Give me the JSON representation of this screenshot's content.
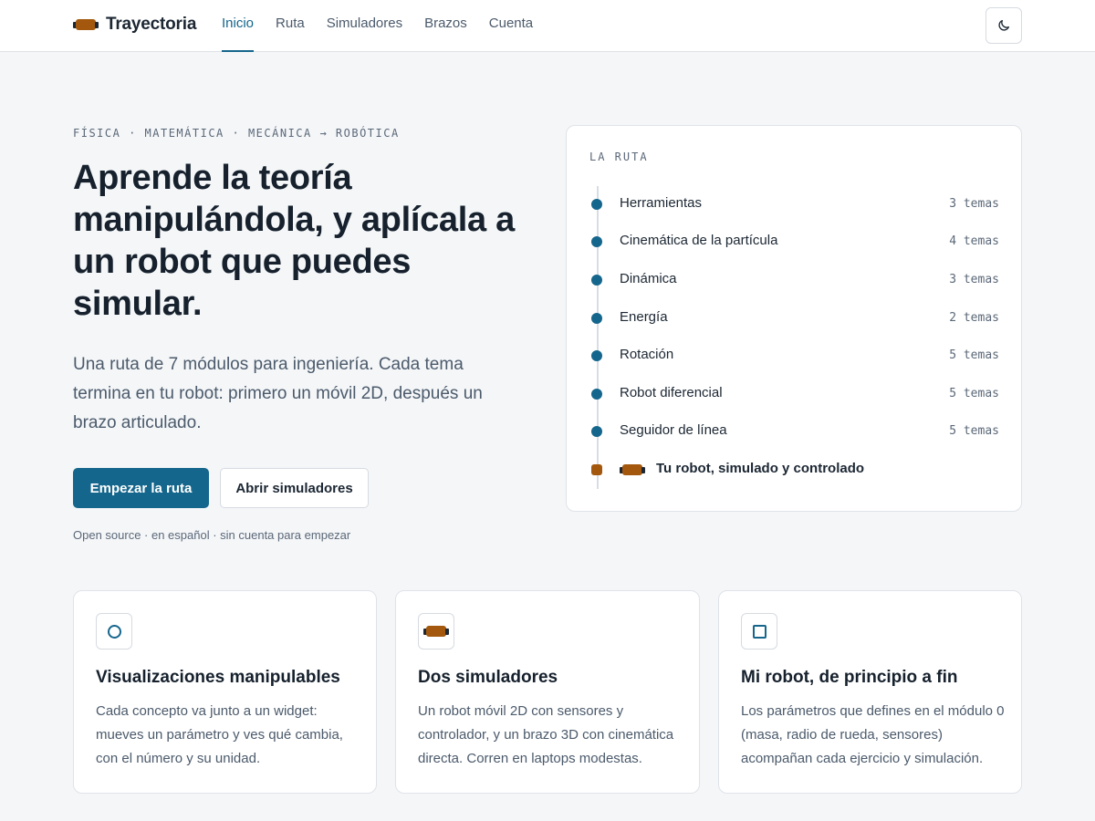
{
  "header": {
    "brand": "Trayectoria",
    "nav": [
      "Inicio",
      "Ruta",
      "Simuladores",
      "Brazos",
      "Cuenta"
    ],
    "active_nav": "Inicio",
    "theme_icon": "moon-icon"
  },
  "hero": {
    "eyebrow": "FÍSICA · MATEMÁTICA · MECÁNICA → ROBÓTICA",
    "title": "Aprende la teoría manipulándola, y aplícala a un robot que puedes simular.",
    "description": "Una ruta de 7 módulos para ingeniería. Cada tema termina en tu robot: primero un móvil 2D, después un brazo articulado.",
    "primary_button": "Empezar la ruta",
    "secondary_button": "Abrir simuladores",
    "footnote": "Open source · en español · sin cuenta para empezar"
  },
  "route": {
    "label": "LA RUTA",
    "items": [
      {
        "label": "Herramientas",
        "count": "3 temas"
      },
      {
        "label": "Cinemática de la partícula",
        "count": "4 temas"
      },
      {
        "label": "Dinámica",
        "count": "3 temas"
      },
      {
        "label": "Energía",
        "count": "2 temas"
      },
      {
        "label": "Rotación",
        "count": "5 temas"
      },
      {
        "label": "Robot diferencial",
        "count": "5 temas"
      },
      {
        "label": "Seguidor de línea",
        "count": "5 temas"
      }
    ],
    "final": "Tu robot, simulado y controlado"
  },
  "features": [
    {
      "icon": "circle-icon",
      "title": "Visualizaciones manipulables",
      "description": "Cada concepto va junto a un widget: mueves un parámetro y ves qué cambia, con el número y su unidad."
    },
    {
      "icon": "robot-icon",
      "title": "Dos simuladores",
      "description": "Un robot móvil 2D con sensores y controlador, y un brazo 3D con cinemática directa. Corren en laptops modestas."
    },
    {
      "icon": "square-icon",
      "title": "Mi robot, de principio a fin",
      "description": "Los parámetros que defines en el módulo 0 (masa, radio de rueda, sensores) acompañan cada ejercicio y simulación."
    }
  ],
  "colors": {
    "accent": "#15668c",
    "robot": "#a3580d",
    "background": "#f4f6f8"
  }
}
